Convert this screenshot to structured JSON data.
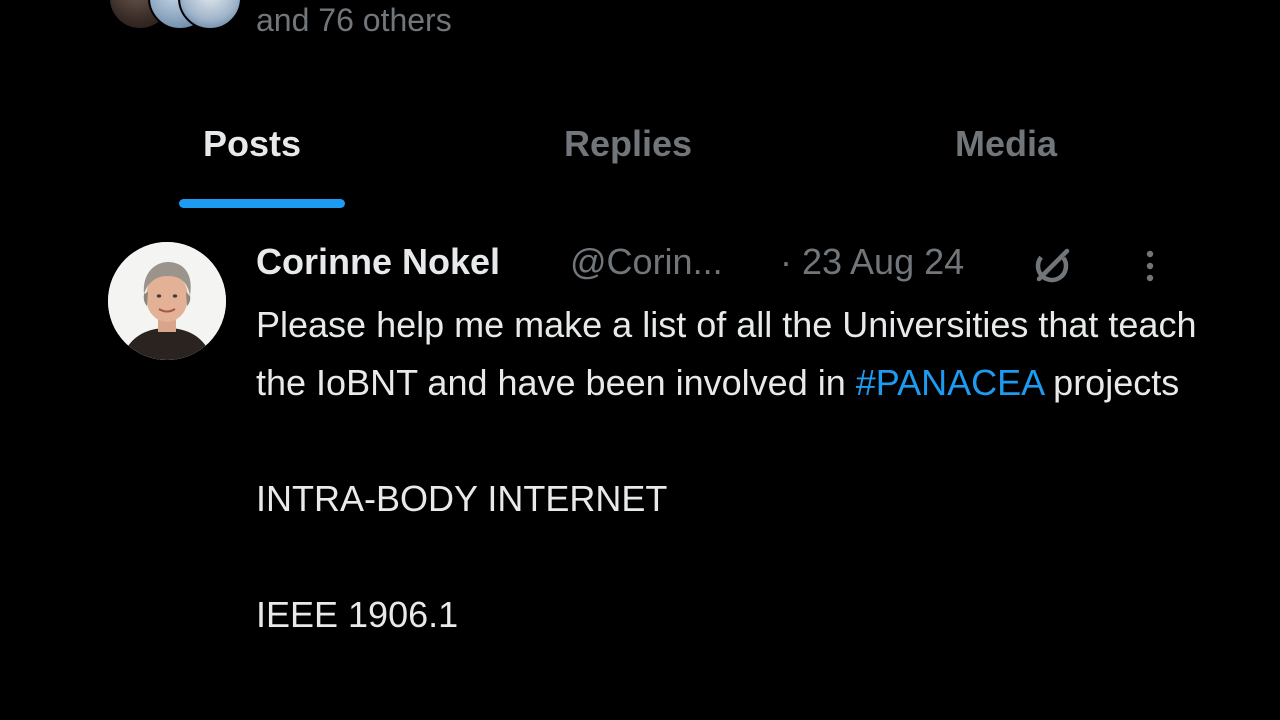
{
  "followers": {
    "text": "and 76 others"
  },
  "tabs": [
    {
      "label": "Posts",
      "active": true
    },
    {
      "label": "Replies",
      "active": false
    },
    {
      "label": "Media",
      "active": false
    }
  ],
  "post": {
    "author_name": "Corinne Nokel",
    "author_handle": "@Corin...",
    "date": "· 23 Aug 24",
    "body": {
      "line_before_hashtag": "Please help me make a list of all the Universities that teach the IoBNT and have been involved in ",
      "hashtag": "#PANACEA",
      "line_after_hashtag": " projects",
      "paragraph_2": "INTRA-BODY INTERNET",
      "paragraph_3": "IEEE 1906.1"
    },
    "icons": {
      "grok": "grok-icon",
      "more": "more-options-icon"
    }
  },
  "colors": {
    "background": "#000000",
    "text_primary": "#e7e9ea",
    "text_secondary": "#71767b",
    "accent": "#1d9bf0"
  }
}
